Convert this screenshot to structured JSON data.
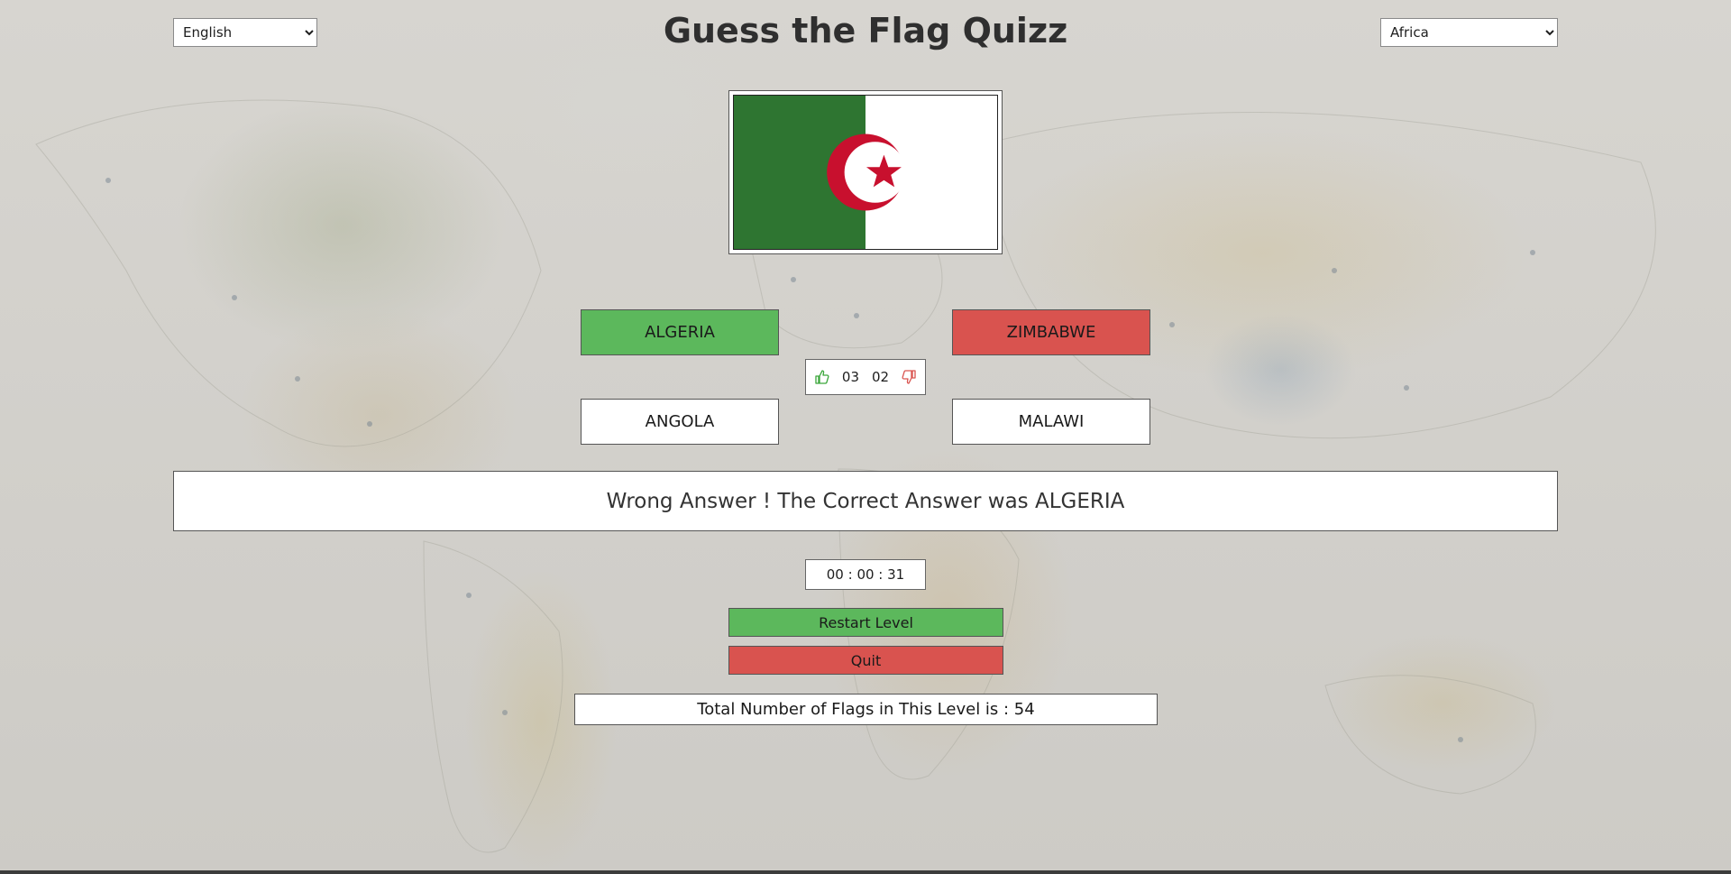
{
  "title": "Guess the Flag Quizz",
  "language_select": {
    "selected": "English"
  },
  "region_select": {
    "selected": "Africa"
  },
  "flag": {
    "icon": "algeria-flag",
    "colors": {
      "green": "#2e7531",
      "white": "#ffffff",
      "red": "#c8102e"
    }
  },
  "answers": [
    {
      "label": "ALGERIA",
      "state": "correct"
    },
    {
      "label": "ZIMBABWE",
      "state": "wrong"
    },
    {
      "label": "ANGOLA",
      "state": "neutral"
    },
    {
      "label": "MALAWI",
      "state": "neutral"
    }
  ],
  "score": {
    "correct": "03",
    "wrong": "02",
    "correct_icon": "thumbs-up-icon",
    "wrong_icon": "thumbs-down-icon"
  },
  "feedback": "Wrong Answer ! The Correct Answer was ALGERIA",
  "timer": "00 : 00 : 31",
  "buttons": {
    "restart_label": "Restart Level",
    "quit_label": "Quit"
  },
  "total_flags": "Total Number of Flags in This Level is : 54",
  "colors": {
    "correct": "#5cb85c",
    "wrong": "#d9534f",
    "title": "#2f2f2f"
  }
}
